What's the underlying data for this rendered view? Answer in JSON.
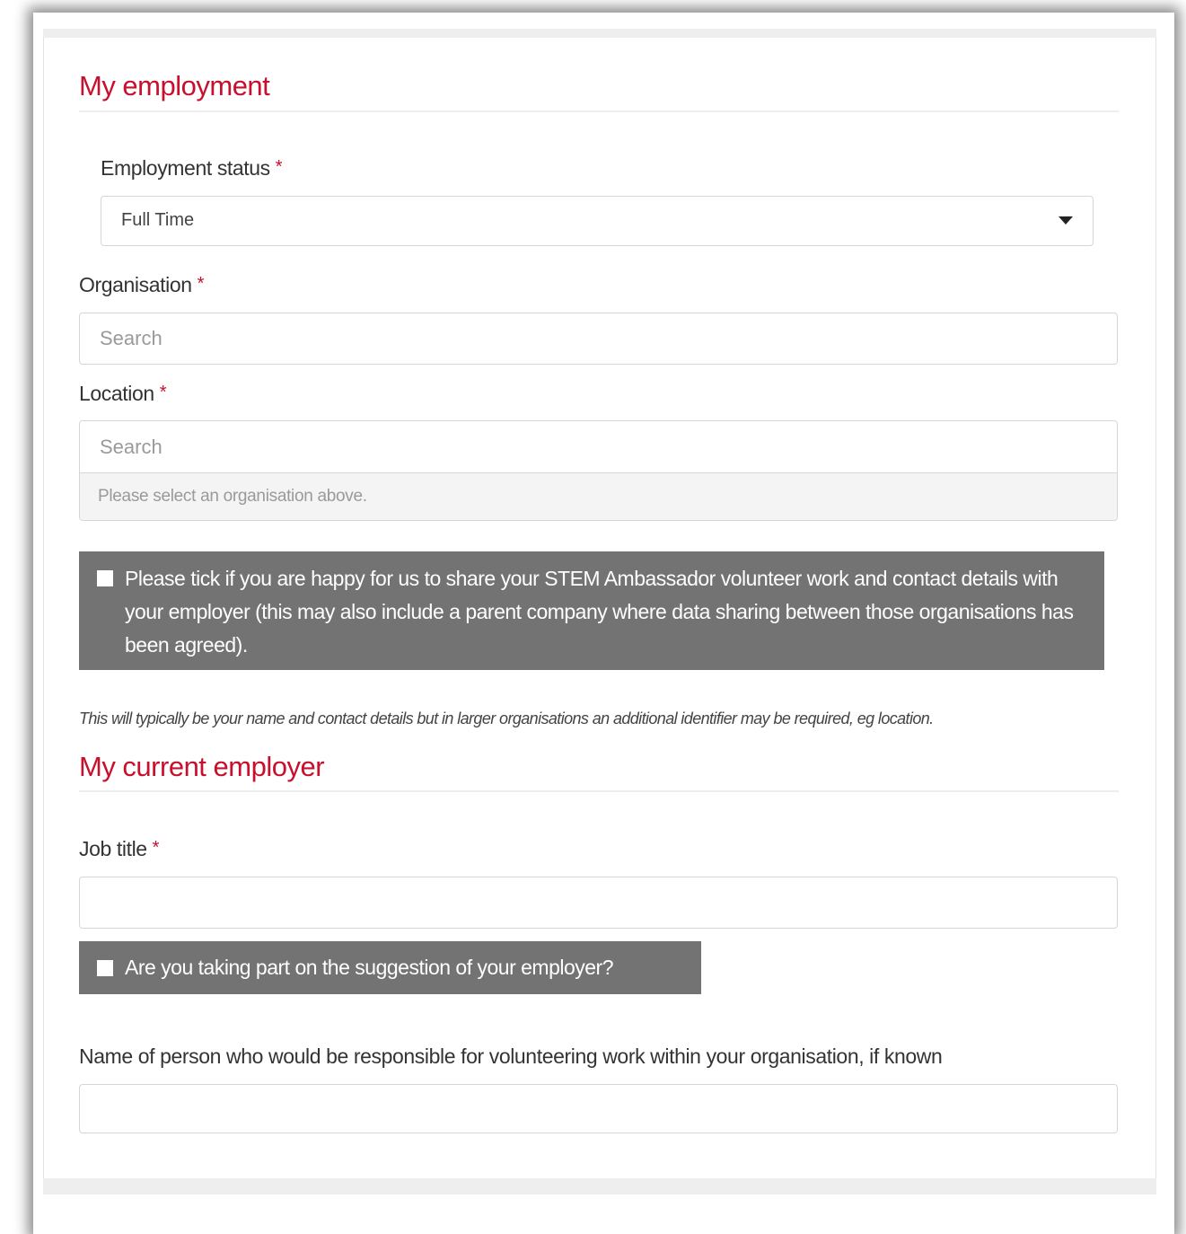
{
  "employment": {
    "title": "My employment",
    "status_label": "Employment status",
    "status_value": "Full Time",
    "organisation_label": "Organisation",
    "organisation_placeholder": "Search",
    "location_label": "Location",
    "location_placeholder": "Search",
    "location_help": "Please select an organisation above.",
    "share_consent": "Please tick if you are happy for us to share your STEM Ambassador volunteer work and contact details with your employer (this may also include a parent company where data sharing between those organisations has been agreed).",
    "share_note": "This will typically be your name and contact details but in larger organisations an additional identifier may be required, eg location."
  },
  "current_employer": {
    "title": "My current employer",
    "job_title_label": "Job title",
    "job_title_value": "",
    "suggestion_label": "Are you taking part on the suggestion of your employer?",
    "responsible_label": "Name of person who would be responsible for volunteering work within your organisation, if known",
    "responsible_value": ""
  },
  "required_marker": "*",
  "colors": {
    "accent": "#c8102e",
    "consent_bg": "#737373"
  },
  "icons": {
    "dropdown": "caret-down-icon"
  }
}
